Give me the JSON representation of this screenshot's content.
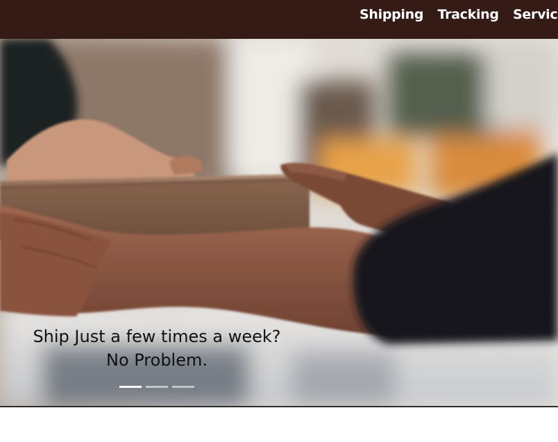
{
  "nav": {
    "items": [
      {
        "label": "Shipping"
      },
      {
        "label": "Tracking"
      },
      {
        "label": "Services"
      }
    ]
  },
  "hero": {
    "caption_line1": "Ship Just a few times a week?",
    "caption_line2": "No Problem.",
    "slides": {
      "count": 3,
      "active": 1
    }
  },
  "colors": {
    "nav_background": "#341b16",
    "nav_text": "#ffffff",
    "caption_text": "#111111"
  }
}
